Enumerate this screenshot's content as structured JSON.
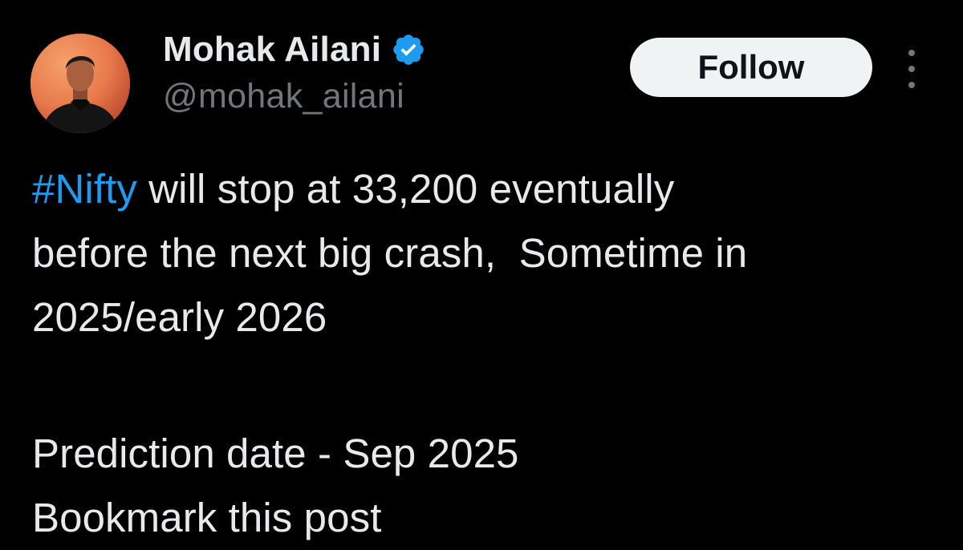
{
  "author": {
    "display_name": "Mohak Ailani",
    "handle": "@mohak_ailani",
    "verified_icon": "verified-badge-icon",
    "avatar_icon": "avatar-photo"
  },
  "actions": {
    "follow_label": "Follow",
    "more_icon": "more-options-icon"
  },
  "post": {
    "hashtag": "#Nifty",
    "line1_rest": " will stop at 33,200 eventually",
    "line2": "before the next big crash,  Sometime in",
    "line3": "2025/early 2026",
    "line4": "Prediction date - Sep 2025",
    "line5": "Bookmark this post"
  },
  "colors": {
    "background": "#000000",
    "text_primary": "#e7e9ea",
    "text_secondary": "#71767b",
    "accent": "#1d9bf0",
    "follow_bg": "#eff3f4"
  }
}
